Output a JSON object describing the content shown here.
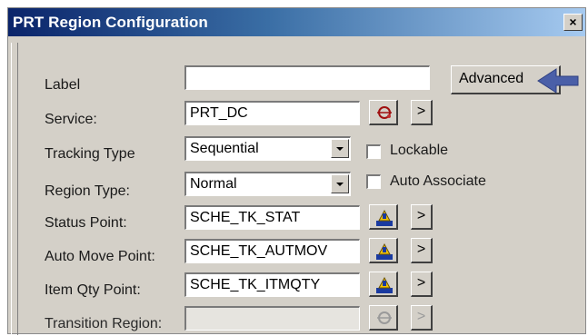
{
  "window": {
    "title": "PRT Region Configuration",
    "close_label": "×"
  },
  "form": {
    "label": {
      "label": "Label",
      "value": ""
    },
    "service": {
      "label": "Service:",
      "value": "PRT_DC",
      "more": ">"
    },
    "tracking_type": {
      "label": "Tracking Type",
      "value": "Sequential"
    },
    "region_type": {
      "label": "Region Type:",
      "value": "Normal"
    },
    "status_point": {
      "label": "Status Point:",
      "value": "SCHE_TK_STAT",
      "more": ">"
    },
    "auto_move_point": {
      "label": "Auto Move Point:",
      "value": "SCHE_TK_AUTMOV",
      "more": ">"
    },
    "item_qty_point": {
      "label": "Item Qty Point:",
      "value": "SCHE_TK_ITMQTY",
      "more": ">"
    },
    "transition_region": {
      "label": "Transition Region:",
      "value": "",
      "more": ">"
    }
  },
  "options": {
    "lockable": {
      "label": "Lockable",
      "checked": false
    },
    "auto_associate": {
      "label": "Auto Associate",
      "checked": false
    }
  },
  "advanced_button": {
    "label": "Advanced"
  },
  "colors": {
    "title_start": "#0a246a",
    "title_end": "#a6caf0",
    "dialog_bg": "#d4d0c8",
    "arrow": "#4a5fa8"
  },
  "icons": [
    "service-browse-icon",
    "point-browse-icon",
    "chevron-right-icon",
    "dropdown-arrow-icon",
    "close-icon",
    "pointer-arrow-icon"
  ]
}
